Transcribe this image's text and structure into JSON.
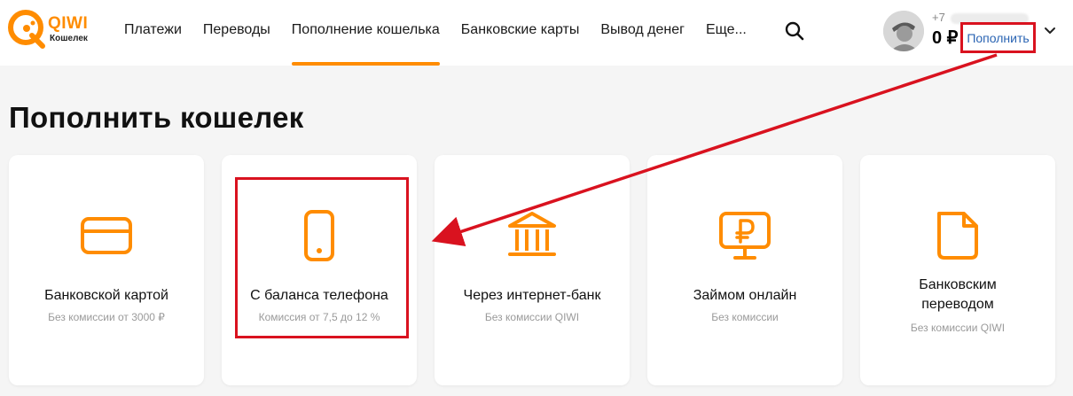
{
  "logo": {
    "brand": "QIWI",
    "sub": "Кошелек"
  },
  "nav": [
    {
      "label": "Платежи",
      "active": false
    },
    {
      "label": "Переводы",
      "active": false
    },
    {
      "label": "Пополнение кошелька",
      "active": true
    },
    {
      "label": "Банковские карты",
      "active": false
    },
    {
      "label": "Вывод денег",
      "active": false
    },
    {
      "label": "Еще...",
      "active": false
    }
  ],
  "account": {
    "phone_prefix": "+7",
    "balance": "0 ₽",
    "topup_label": "Пополнить"
  },
  "page": {
    "title": "Пополнить кошелек"
  },
  "cards": [
    {
      "title": "Банковской картой",
      "sub": "Без комиссии от 3000 ₽",
      "icon": "card-icon"
    },
    {
      "title": "С баланса телефона",
      "sub": "Комиссия от 7,5 до 12 %",
      "icon": "phone-icon"
    },
    {
      "title": "Через интернет-банк",
      "sub": "Без комиссии QIWI",
      "icon": "bank-icon"
    },
    {
      "title": "Займом онлайн",
      "sub": "Без комиссии",
      "icon": "ruble-monitor-icon"
    },
    {
      "title": "Банковским переводом",
      "sub": "Без комиссии QIWI",
      "icon": "document-icon"
    }
  ],
  "colors": {
    "accent": "#ff8c00",
    "highlight": "#d9121f",
    "link": "#2a64b3"
  }
}
